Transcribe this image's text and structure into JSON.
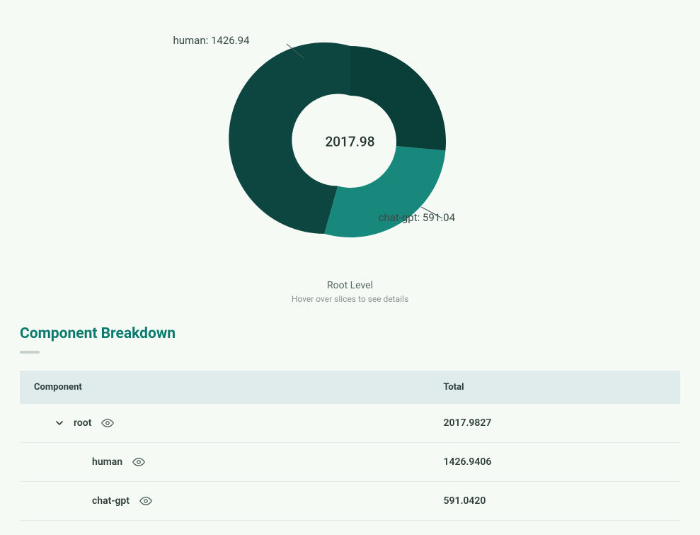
{
  "chart_data": {
    "type": "pie",
    "title": "",
    "total_label": "2017.98",
    "series": [
      {
        "name": "human",
        "value": 1426.94,
        "label": "human: 1426.94",
        "color": "#0d4641"
      },
      {
        "name": "chat-gpt",
        "value": 591.04,
        "label": "chat-gpt: 591.04",
        "color": "#17887b"
      }
    ]
  },
  "caption": {
    "main": "Root Level",
    "sub": "Hover over slices to see details"
  },
  "breakdown": {
    "title": "Component Breakdown",
    "headers": {
      "component": "Component",
      "total": "Total"
    },
    "rows": [
      {
        "name": "root",
        "total": "2017.9827",
        "depth": 0,
        "expandable": true
      },
      {
        "name": "human",
        "total": "1426.9406",
        "depth": 1,
        "expandable": false
      },
      {
        "name": "chat-gpt",
        "total": "591.0420",
        "depth": 1,
        "expandable": false
      }
    ]
  }
}
